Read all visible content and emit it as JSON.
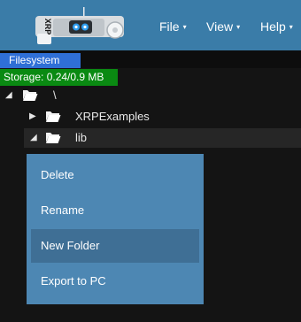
{
  "header": {
    "logo": {
      "text": "XRP",
      "icon": "xrp-robot-logo-icon"
    },
    "menus": [
      {
        "label": "File",
        "caret": "▾"
      },
      {
        "label": "View",
        "caret": "▾"
      },
      {
        "label": "Help",
        "caret": "▾"
      }
    ]
  },
  "panel": {
    "tab_label": "Filesystem",
    "storage_text": "Storage: 0.24/0.9 MB",
    "colors": {
      "tab": "#2f6fd6",
      "storage": "#0a8a12"
    }
  },
  "tree": {
    "items": [
      {
        "label": "\\",
        "expanded": true,
        "arrow": "◢",
        "icon": "folder-open-icon"
      },
      {
        "label": "XRPExamples",
        "expanded": false,
        "arrow": "▶",
        "icon": "folder-open-icon"
      },
      {
        "label": "lib",
        "expanded": true,
        "arrow": "◢",
        "icon": "folder-open-icon",
        "selected": true
      }
    ]
  },
  "context_menu": {
    "items": [
      {
        "label": "Delete"
      },
      {
        "label": "Rename"
      },
      {
        "label": "New Folder",
        "hovered": true
      },
      {
        "label": "Export to PC"
      }
    ]
  },
  "colors": {
    "header": "#3a7ca8",
    "background": "#141414",
    "context_menu": "#4d87b3",
    "context_hover": "#3f6f95"
  }
}
